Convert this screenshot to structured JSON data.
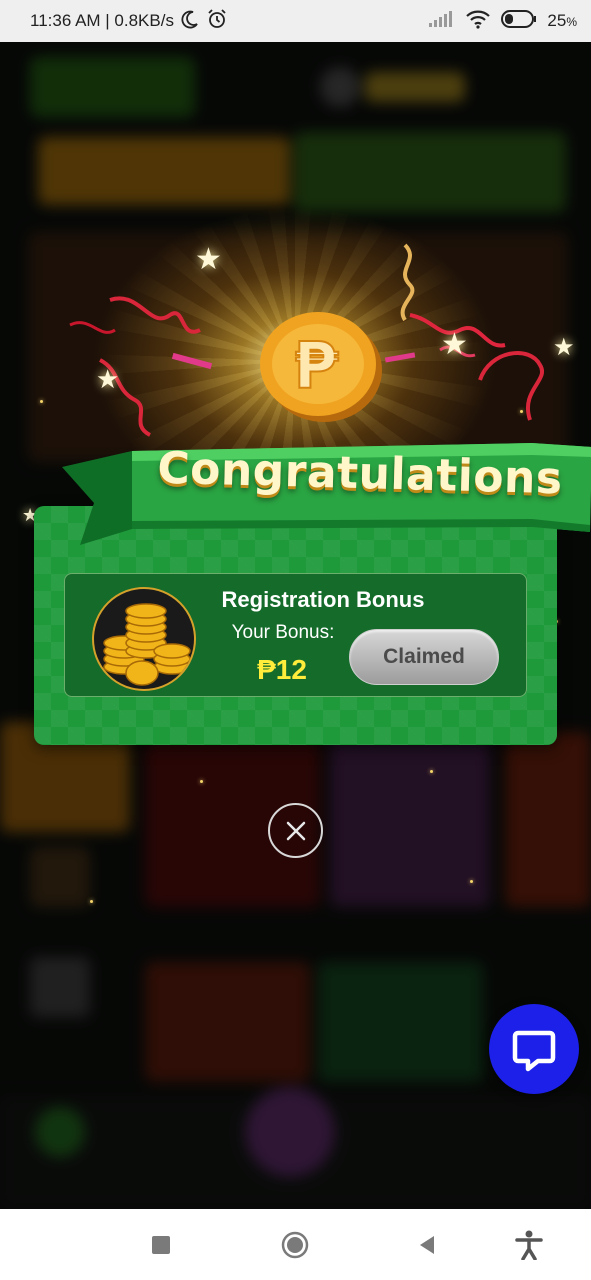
{
  "status_bar": {
    "time_speed": "11:36 AM | 0.8KB/s",
    "battery": "25",
    "battery_unit": "%",
    "icons": [
      "moon-icon",
      "alarm-icon",
      "signal-icon",
      "wifi-icon",
      "battery-icon"
    ]
  },
  "dialog": {
    "heading": "Congratulations",
    "bonus_title": "Registration Bonus",
    "bonus_label": "Your Bonus:",
    "bonus_amount": "₱12",
    "status_button": "Claimed",
    "coin_symbol": "₱"
  },
  "colors": {
    "panel_green": "#1f9a3b",
    "amount_yellow": "#ffec3b",
    "chat_blue": "#1c20e8",
    "coin_gold": "#f0a320"
  },
  "navigation_bar": {
    "buttons": [
      "recents-square-icon",
      "home-circle-icon",
      "back-triangle-icon",
      "accessibility-icon"
    ]
  }
}
